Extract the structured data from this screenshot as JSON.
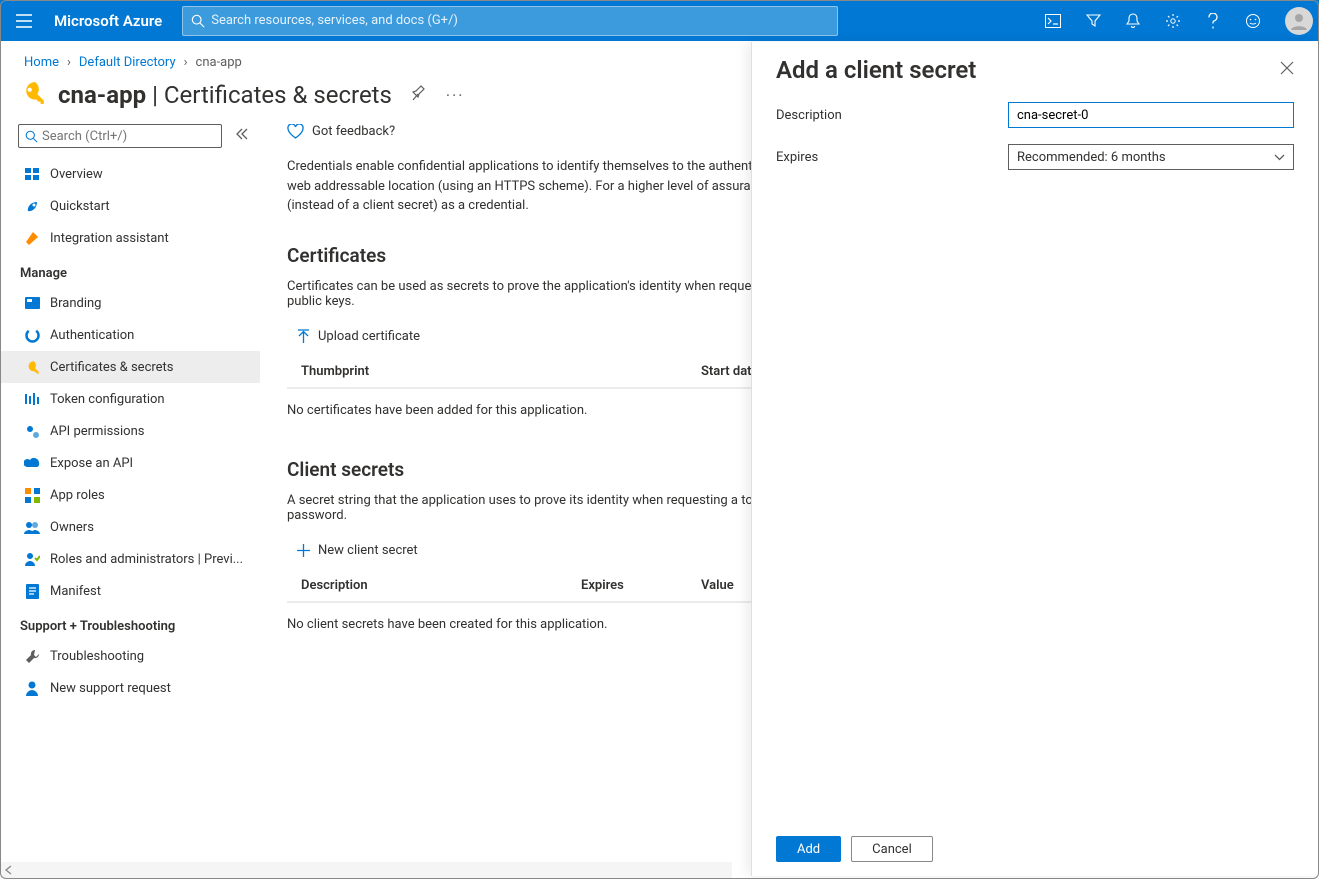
{
  "brand": "Microsoft Azure",
  "search_placeholder": "Search resources, services, and docs (G+/)",
  "breadcrumb": {
    "items": [
      "Home",
      "Default Directory",
      "cna-app"
    ]
  },
  "page": {
    "app_name": "cna-app",
    "section": "Certificates & secrets"
  },
  "sidebar": {
    "search_placeholder": "Search (Ctrl+/)",
    "items_top": [
      {
        "label": "Overview"
      },
      {
        "label": "Quickstart"
      },
      {
        "label": "Integration assistant"
      }
    ],
    "manage_heading": "Manage",
    "items_manage": [
      {
        "label": "Branding"
      },
      {
        "label": "Authentication"
      },
      {
        "label": "Certificates & secrets",
        "active": true
      },
      {
        "label": "Token configuration"
      },
      {
        "label": "API permissions"
      },
      {
        "label": "Expose an API"
      },
      {
        "label": "App roles"
      },
      {
        "label": "Owners"
      },
      {
        "label": "Roles and administrators | Previ..."
      },
      {
        "label": "Manifest"
      }
    ],
    "support_heading": "Support + Troubleshooting",
    "items_support": [
      {
        "label": "Troubleshooting"
      },
      {
        "label": "New support request"
      }
    ]
  },
  "main": {
    "feedback": "Got feedback?",
    "intro": "Credentials enable confidential applications to identify themselves to the authentication service when receiving tokens at a web addressable location (using an HTTPS scheme). For a higher level of assurance, we recommend using a certificate (instead of a client secret) as a credential.",
    "certs": {
      "title": "Certificates",
      "subtitle": "Certificates can be used as secrets to prove the application's identity when requesting a token. Also can be referred to as public keys.",
      "upload_label": "Upload certificate",
      "cols": {
        "a": "Thumbprint",
        "b": "Start date"
      },
      "empty": "No certificates have been added for this application."
    },
    "secrets": {
      "title": "Client secrets",
      "subtitle": "A secret string that the application uses to prove its identity when requesting a token. Also can be referred to as application password.",
      "new_label": "New client secret",
      "cols": {
        "a": "Description",
        "b": "Expires",
        "c": "Value"
      },
      "empty": "No client secrets have been created for this application."
    }
  },
  "panel": {
    "title": "Add a client secret",
    "description_label": "Description",
    "description_value": "cna-secret-0",
    "expires_label": "Expires",
    "expires_value": "Recommended: 6 months",
    "add_label": "Add",
    "cancel_label": "Cancel"
  }
}
